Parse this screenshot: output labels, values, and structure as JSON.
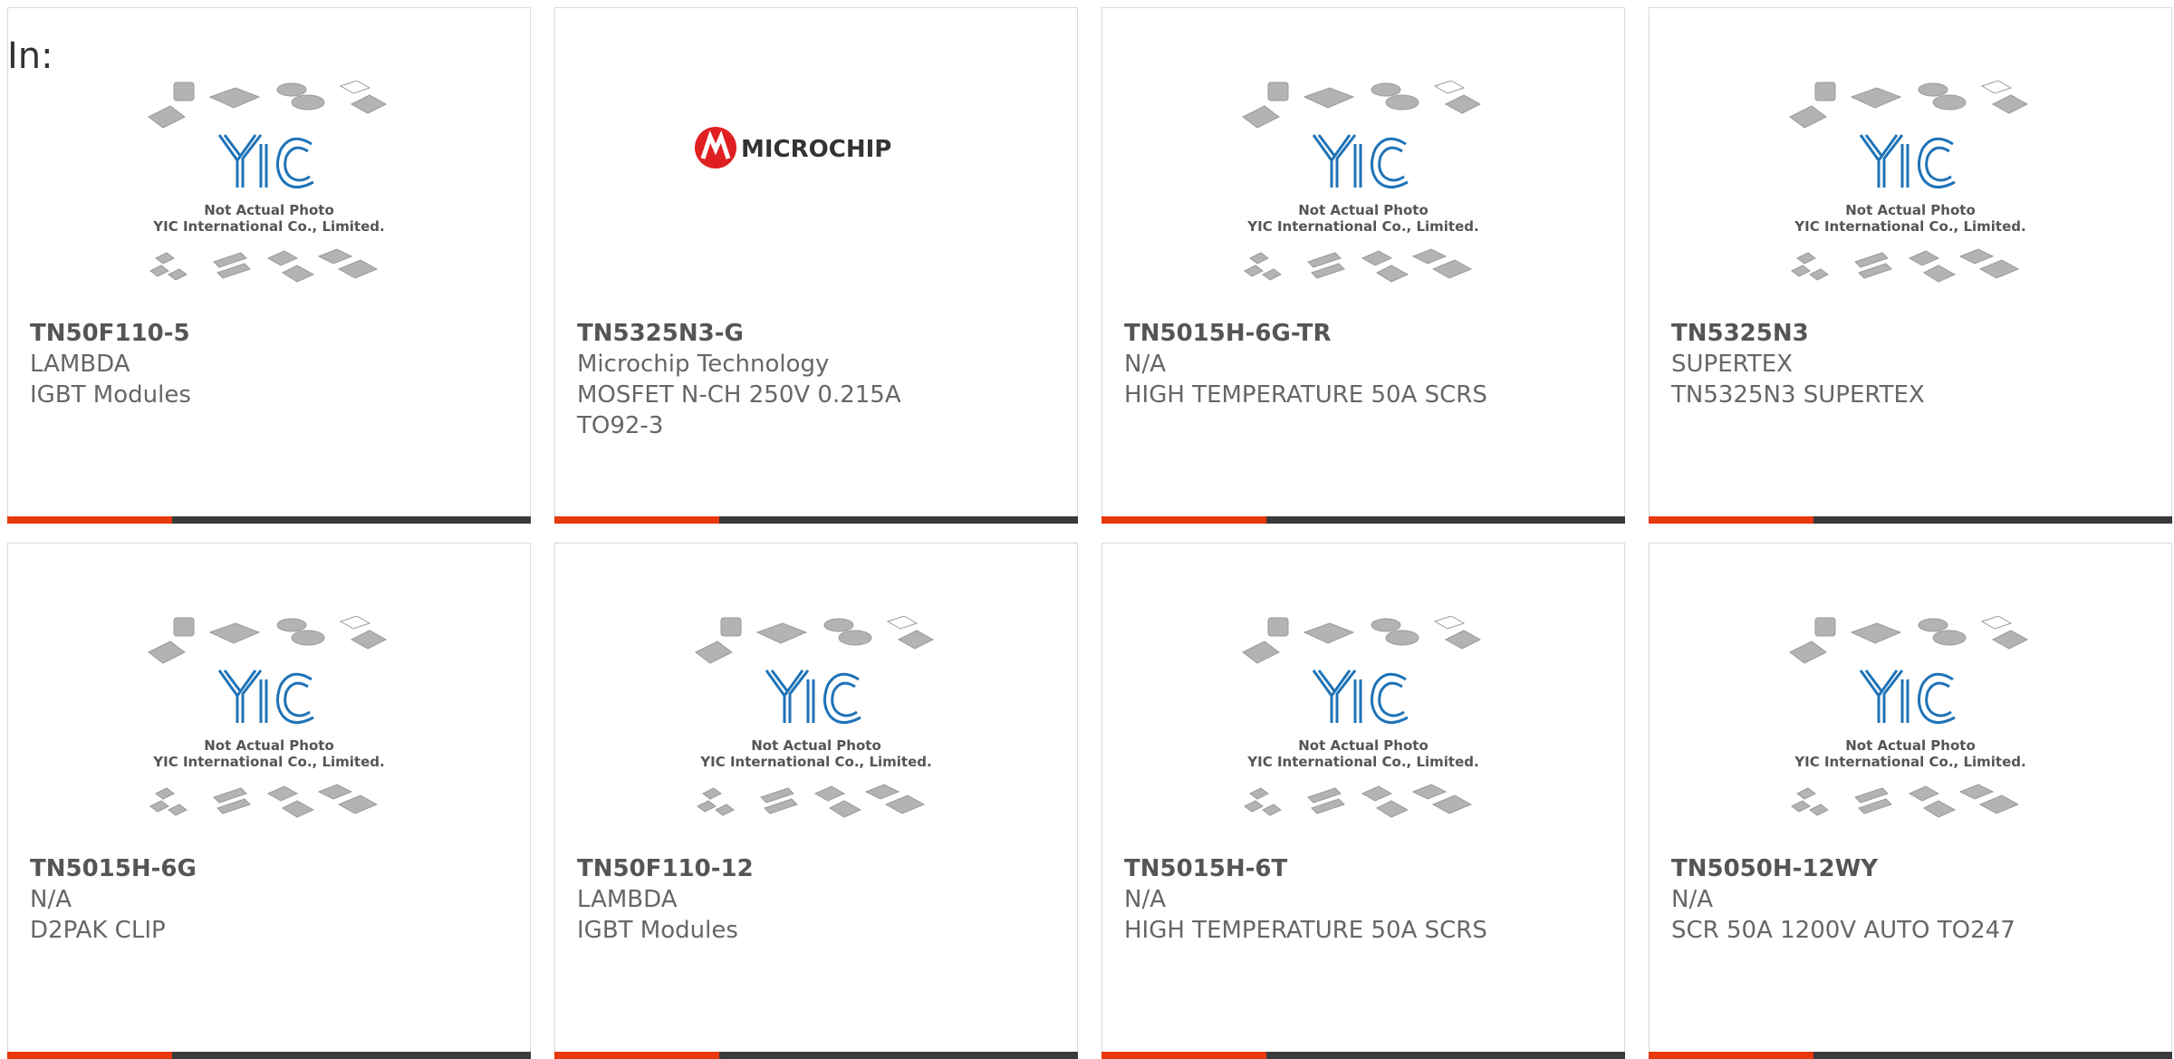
{
  "header": {
    "in_label": "In:"
  },
  "placeholder_image": {
    "line1": "Not Actual Photo",
    "line2": "YIC International Co., Limited.",
    "logo": "YIC"
  },
  "microchip_logo": {
    "text": "MICROCHIP"
  },
  "colors": {
    "accent": "#e8380d",
    "bar": "#3a3a3a",
    "yic_blue": "#1f73b7",
    "microchip_red": "#e02020"
  },
  "products": [
    {
      "part": "TN50F110-5",
      "maker": "LAMBDA",
      "desc1": "IGBT Modules",
      "desc2": "",
      "image": "yic-placeholder"
    },
    {
      "part": "TN5325N3-G",
      "maker": "Microchip Technology",
      "desc1": "MOSFET N-CH 250V 0.215A",
      "desc2": "TO92-3",
      "image": "microchip-logo"
    },
    {
      "part": "TN5015H-6G-TR",
      "maker": "N/A",
      "desc1": "HIGH TEMPERATURE 50A SCRS",
      "desc2": "",
      "image": "yic-placeholder"
    },
    {
      "part": "TN5325N3",
      "maker": "SUPERTEX",
      "desc1": "TN5325N3 SUPERTEX",
      "desc2": "",
      "image": "yic-placeholder"
    },
    {
      "part": "TN5015H-6G",
      "maker": "N/A",
      "desc1": "D2PAK CLIP",
      "desc2": "",
      "image": "yic-placeholder"
    },
    {
      "part": "TN50F110-12",
      "maker": "LAMBDA",
      "desc1": "IGBT Modules",
      "desc2": "",
      "image": "yic-placeholder"
    },
    {
      "part": "TN5015H-6T",
      "maker": "N/A",
      "desc1": "HIGH TEMPERATURE 50A SCRS",
      "desc2": "",
      "image": "yic-placeholder"
    },
    {
      "part": "TN5050H-12WY",
      "maker": "N/A",
      "desc1": "SCR 50A 1200V AUTO TO247",
      "desc2": "",
      "image": "yic-placeholder"
    }
  ]
}
